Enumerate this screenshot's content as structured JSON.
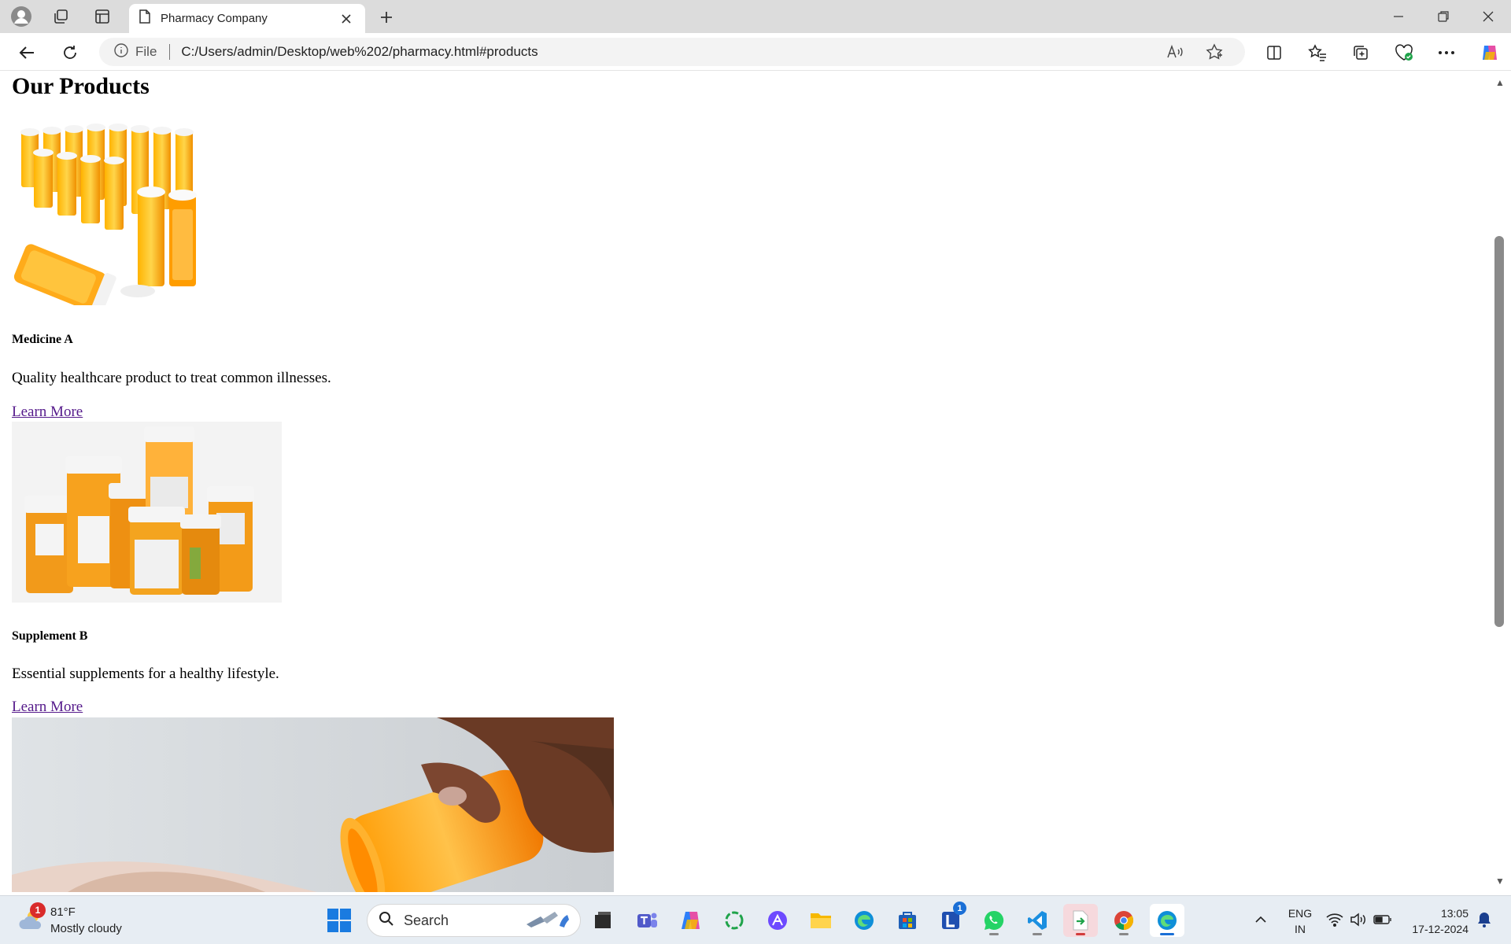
{
  "browser": {
    "tab_title": "Pharmacy Company",
    "address_scheme": "File",
    "address_url": "C:/Users/admin/Desktop/web%202/pharmacy.html#products"
  },
  "page": {
    "heading": "Our Products",
    "products": [
      {
        "name": "Medicine A",
        "description": "Quality healthcare product to treat common illnesses.",
        "link": "Learn More"
      },
      {
        "name": "Supplement B",
        "description": "Essential supplements for a healthy lifestyle.",
        "link": "Learn More"
      }
    ]
  },
  "taskbar": {
    "weather_temp": "81°F",
    "weather_condition": "Mostly cloudy",
    "weather_badge": "1",
    "search_label": "Search",
    "teams_like_badge": "1",
    "language_line1": "ENG",
    "language_line2": "IN",
    "time": "13:05",
    "date": "17-12-2024"
  },
  "colors": {
    "visited_link": "#551a8b",
    "pill_orange": "#f5a623",
    "taskbar_bg": "#e7edf3"
  }
}
